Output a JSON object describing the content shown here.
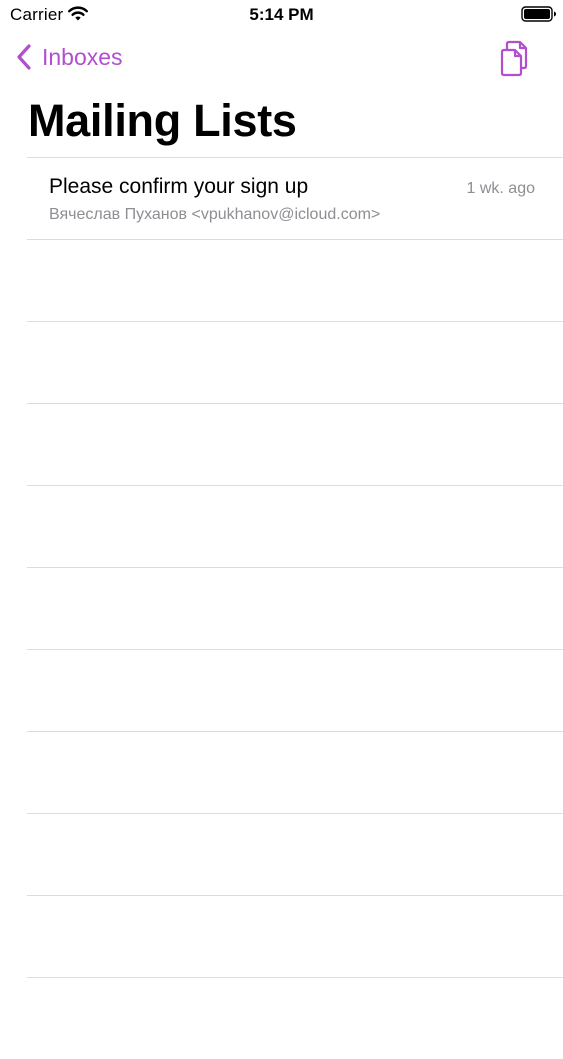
{
  "status_bar": {
    "carrier": "Carrier",
    "time": "5:14 PM"
  },
  "nav": {
    "back_label": "Inboxes",
    "back_icon": "chevron-left-icon",
    "action_icon": "copy-documents-icon",
    "title": "Mailing Lists"
  },
  "colors": {
    "accent": "#b14fd0",
    "secondary_text": "#8e8e93",
    "separator": "#dcdcdc"
  },
  "messages": [
    {
      "subject": "Please confirm your sign up",
      "date": "1 wk. ago",
      "sender": "Вячеслав Пуханов <vpukhanov@icloud.com>"
    }
  ]
}
